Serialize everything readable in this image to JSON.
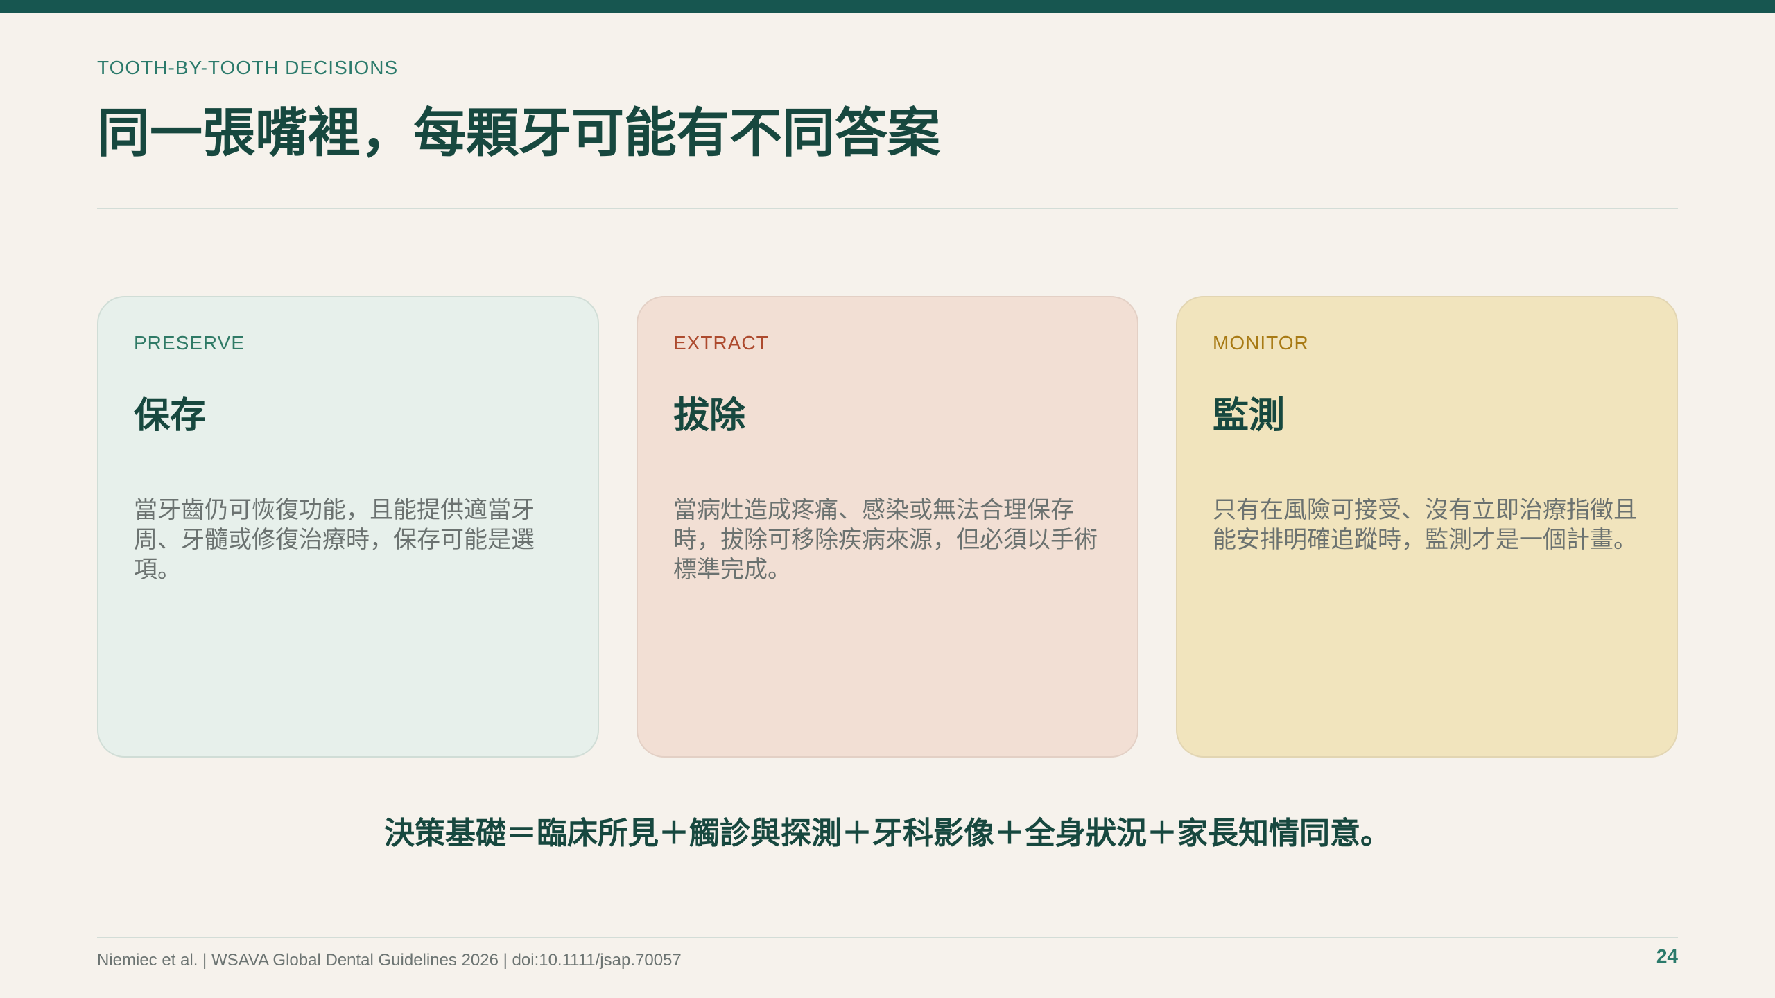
{
  "slide": {
    "eyebrow": "TOOTH-BY-TOOTH DECISIONS",
    "title": "同一張嘴裡，每顆牙可能有不同答案"
  },
  "cards": [
    {
      "tag": "PRESERVE",
      "title": "保存",
      "body": "當牙齒仍可恢復功能，且能提供適當牙周、牙髓或修復治療時，保存可能是選項。"
    },
    {
      "tag": "EXTRACT",
      "title": "拔除",
      "body": "當病灶造成疼痛、感染或無法合理保存時，拔除可移除疾病來源，但必須以手術標準完成。"
    },
    {
      "tag": "MONITOR",
      "title": "監測",
      "body": "只有在風險可接受、沒有立即治療指徵且能安排明確追蹤時，監測才是一個計畫。"
    }
  ],
  "summary": "決策基礎＝臨床所見＋觸診與探測＋牙科影像＋全身狀況＋家長知情同意。",
  "footer": {
    "citation": "Niemiec et al. | WSAVA Global Dental Guidelines 2026 | doi:10.1111/jsap.70057",
    "page_number": "24"
  },
  "colors": {
    "brand": "#175650",
    "background": "#f6f2ec",
    "preserve": "#2f7a66",
    "extract": "#ad4a2e",
    "monitor": "#a87a14"
  }
}
